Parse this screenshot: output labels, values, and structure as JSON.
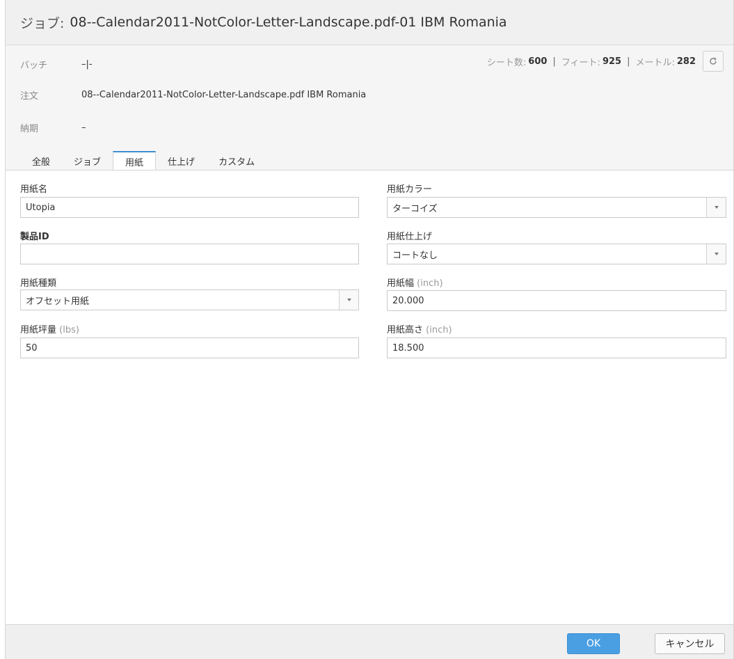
{
  "title": {
    "prefix": "ジョブ:",
    "name": "08--Calendar2011-NotColor-Letter-Landscape.pdf-01 IBM Romania"
  },
  "meta": {
    "batch_label": "バッチ",
    "batch_value": "–|-",
    "order_label": "注文",
    "order_value": "08--Calendar2011-NotColor-Letter-Landscape.pdf IBM Romania",
    "due_label": "納期",
    "due_value": "–"
  },
  "stats": {
    "sheets_label": "シート数:",
    "sheets_value": "600",
    "sep1": "|",
    "feet_label": "フィート:",
    "feet_value": "925",
    "sep2": "|",
    "meters_label": "メートル:",
    "meters_value": "282",
    "refresh_icon": "refresh-icon"
  },
  "tabs": [
    {
      "label": "全般",
      "active": false
    },
    {
      "label": "ジョブ",
      "active": false
    },
    {
      "label": "用紙",
      "active": true
    },
    {
      "label": "仕上げ",
      "active": false
    },
    {
      "label": "カスタム",
      "active": false
    }
  ],
  "form": {
    "paper_name": {
      "label": "用紙名",
      "value": "Utopia"
    },
    "product_id": {
      "label": "製品ID",
      "value": ""
    },
    "paper_type": {
      "label": "用紙種類",
      "value": "オフセット用紙"
    },
    "paper_weight": {
      "label": "用紙坪量",
      "unit": "(lbs)",
      "value": "50"
    },
    "paper_color": {
      "label": "用紙カラー",
      "value": "ターコイズ"
    },
    "paper_finish": {
      "label": "用紙仕上げ",
      "value": "コートなし"
    },
    "paper_width": {
      "label": "用紙幅",
      "unit": "(inch)",
      "value": "20.000"
    },
    "paper_height": {
      "label": "用紙高さ",
      "unit": "(inch)",
      "value": "18.500"
    }
  },
  "footer": {
    "ok_label": "OK",
    "cancel_label": "キャンセル"
  },
  "colors": {
    "accent": "#4a9fe3",
    "tab_active_border": "#3d8fd5"
  }
}
